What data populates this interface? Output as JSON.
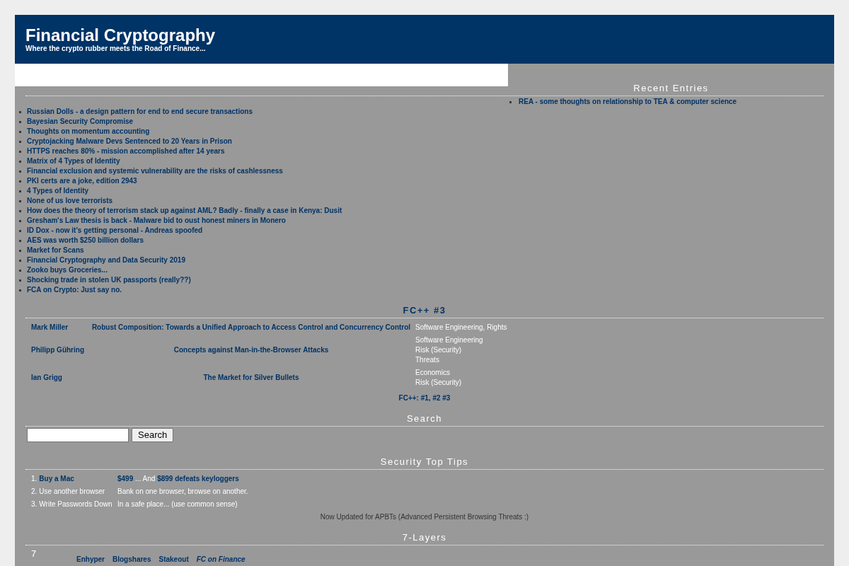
{
  "header": {
    "title": "Financial Cryptography",
    "tagline": "Where the crypto rubber meets the Road of Finance..."
  },
  "recent_entries": {
    "heading": {
      "text": "Recent Entries",
      "is_link": false
    },
    "items": [
      "REA - some thoughts on relationship to TEA & computer science",
      "Russian Dolls - a design pattern for end to end secure transactions",
      "Bayesian Security Compromise",
      "Thoughts on momentum accounting",
      "Cryptojacking Malware Devs Sentenced to 20 Years in Prison",
      "HTTPS reaches 80% - mission accomplished after 14 years",
      "Matrix of 4 Types of Identity",
      "Financial exclusion and systemic vulnerability are the risks of cashlessness",
      "PKI certs are a joke, edition 2943",
      "4 Types of Identity",
      "None of us love terrorists",
      "How does the theory of terrorism stack up against AML? Badly - finally a case in Kenya: Dusit",
      "Gresham's Law thesis is back - Malware bid to oust honest miners in Monero",
      "ID Dox - now it's getting personal - Andreas spoofed",
      "AES was worth $250 billion dollars",
      "Market for Scans",
      "Financial Cryptography and Data Security 2019",
      "Zooko buys Groceries...",
      "Shocking trade in stolen UK passports (really??)",
      "FCA on Crypto: Just say no."
    ]
  },
  "fcpp": {
    "heading": {
      "text": "FC++ #3",
      "is_link": true
    },
    "papers": [
      {
        "author": "Mark Miller",
        "title": "Robust Composition: Towards a Unified Approach to Access Control and Concurrency Control",
        "categories": [
          "Software Engineering, Rights"
        ]
      },
      {
        "author": "Philipp Gühring",
        "title": "Concepts against Man-in-the-Browser Attacks",
        "categories": [
          "Software Engineering",
          "Risk (Security)",
          "Threats"
        ]
      },
      {
        "author": "Ian Grigg",
        "title": "The Market for Silver Bullets",
        "categories": [
          "Economics",
          "Risk (Security)"
        ]
      }
    ],
    "nav": [
      {
        "kind": "label",
        "text": "FC++:"
      },
      {
        "kind": "link",
        "text": "#1"
      },
      {
        "kind": "punct",
        "text": ","
      },
      {
        "kind": "link",
        "text": "#2"
      },
      {
        "kind": "link",
        "text": "#3"
      }
    ]
  },
  "search": {
    "heading": {
      "text": "Search",
      "is_link": false
    },
    "button": "Search"
  },
  "security_top_tips": {
    "heading": {
      "text": "Security Top Tips",
      "is_link": false
    },
    "tips": [
      {
        "number": "1.",
        "label": {
          "kind": "link",
          "text": "Buy a Mac"
        },
        "detail": [
          {
            "kind": "link",
            "text": "$499"
          },
          {
            "kind": "text",
            "text": "... And"
          },
          {
            "kind": "link",
            "text": "$899 defeats keyloggers"
          }
        ]
      },
      {
        "number": "2.",
        "label": {
          "kind": "text",
          "text": "Use another browser"
        },
        "detail": [
          {
            "kind": "text",
            "text": "Bank on one browser, browse on another."
          }
        ]
      },
      {
        "number": "3.",
        "label": {
          "kind": "text",
          "text": "Write Passwords Down"
        },
        "detail": [
          {
            "kind": "text",
            "text": "In a safe place... (use common sense)"
          }
        ]
      }
    ],
    "note": "Now Updated for APBTs (Advanced Persistent Browsing Threats :)"
  },
  "seven_layers": {
    "heading": {
      "text": "7-Layers",
      "is_link": false
    },
    "number": "7",
    "links": [
      {
        "text": "Enhyper",
        "italic": false
      },
      {
        "text": "Blogshares",
        "italic": false
      },
      {
        "text": "Stakeout",
        "italic": false
      },
      {
        "text": "FC on Finance",
        "italic": true
      }
    ]
  }
}
